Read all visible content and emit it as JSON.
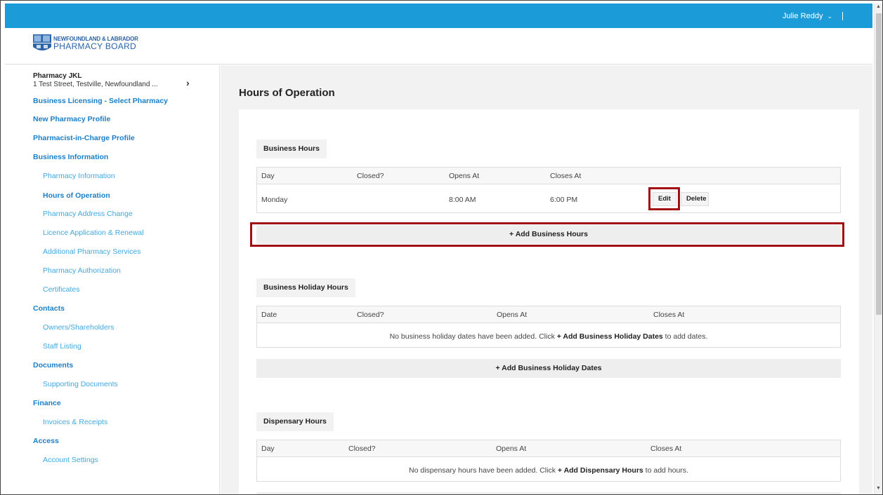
{
  "user_menu": {
    "name": "Julie Reddy",
    "caret": "⌄"
  },
  "logo": {
    "line1": "NEWFOUNDLAND & LABRADOR",
    "line2": "PHARMACY BOARD"
  },
  "pharmacy": {
    "name": "Pharmacy JKL",
    "address": "1 Test Street, Testville, Newfoundland ...",
    "chevron": "›"
  },
  "nav": {
    "business_licensing": "Business Licensing - Select Pharmacy",
    "new_pharmacy_profile": "New Pharmacy Profile",
    "pic_profile": "Pharmacist-in-Charge Profile",
    "business_information": "Business Information",
    "pharmacy_information": "Pharmacy Information",
    "hours_of_operation": "Hours of Operation",
    "pharmacy_address_change": "Pharmacy Address Change",
    "licence_application": "Licence Application & Renewal",
    "additional_services": "Additional Pharmacy Services",
    "pharmacy_authorization": "Pharmacy Authorization",
    "certificates": "Certificates",
    "contacts": "Contacts",
    "owners_shareholders": "Owners/Shareholders",
    "staff_listing": "Staff Listing",
    "documents": "Documents",
    "supporting_documents": "Supporting Documents",
    "finance": "Finance",
    "invoices_receipts": "Invoices & Receipts",
    "access": "Access",
    "account_settings": "Account Settings"
  },
  "page_title": "Hours of Operation",
  "business_hours": {
    "title": "Business Hours",
    "headers": [
      "Day",
      "Closed?",
      "Opens At",
      "Closes At"
    ],
    "rows": [
      {
        "day": "Monday",
        "closed": "",
        "opens": "8:00 AM",
        "closes": "6:00 PM"
      }
    ],
    "edit_label": "Edit",
    "delete_label": "Delete",
    "add_label": "+ Add Business Hours"
  },
  "holiday_hours": {
    "title": "Business Holiday Hours",
    "headers": [
      "Date",
      "Closed?",
      "Opens At",
      "Closes At"
    ],
    "empty_pre": "No business holiday dates have been added. Click ",
    "empty_link": "+ Add Business Holiday Dates",
    "empty_post": " to add dates.",
    "add_label": "+ Add Business Holiday Dates"
  },
  "dispensary_hours": {
    "title": "Dispensary Hours",
    "headers": [
      "Day",
      "Closed?",
      "Opens At",
      "Closes At"
    ],
    "empty_pre": "No dispensary hours have been added. Click ",
    "empty_link": "+ Add Dispensary Hours",
    "empty_post": " to add hours."
  },
  "colors": {
    "topbar": "#1b9cd8",
    "highlight": "#a10f14",
    "nav_link": "#1b9cd8"
  }
}
